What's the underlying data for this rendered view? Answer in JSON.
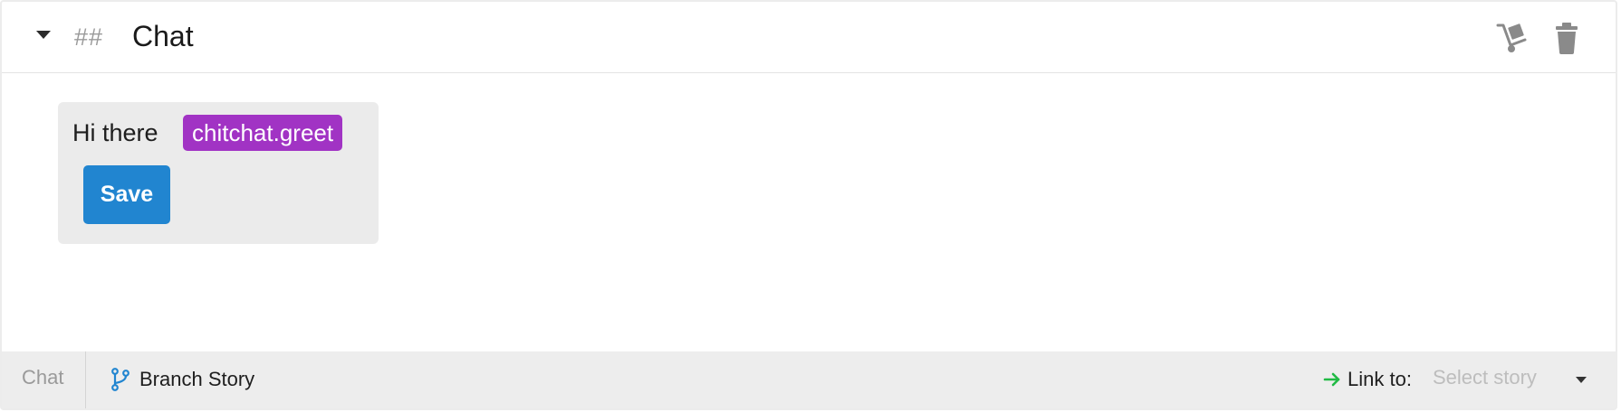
{
  "header": {
    "hashes": "##",
    "title": "Chat",
    "icons": [
      "dolly-icon",
      "trash-icon"
    ]
  },
  "bubble": {
    "text": "Hi there",
    "intent": "chitchat.greet",
    "save_label": "Save"
  },
  "footer": {
    "story_label": "Chat",
    "branch_label": "Branch Story",
    "link_label": "Link to:",
    "select_placeholder": "Select story"
  },
  "colors": {
    "intent_chip": "#a133c4",
    "save_button": "#2185d0",
    "branch_icon": "#2185d0",
    "link_arrow": "#21ba45",
    "footer_bg": "#ededed",
    "bubble_bg": "#ebebeb"
  }
}
